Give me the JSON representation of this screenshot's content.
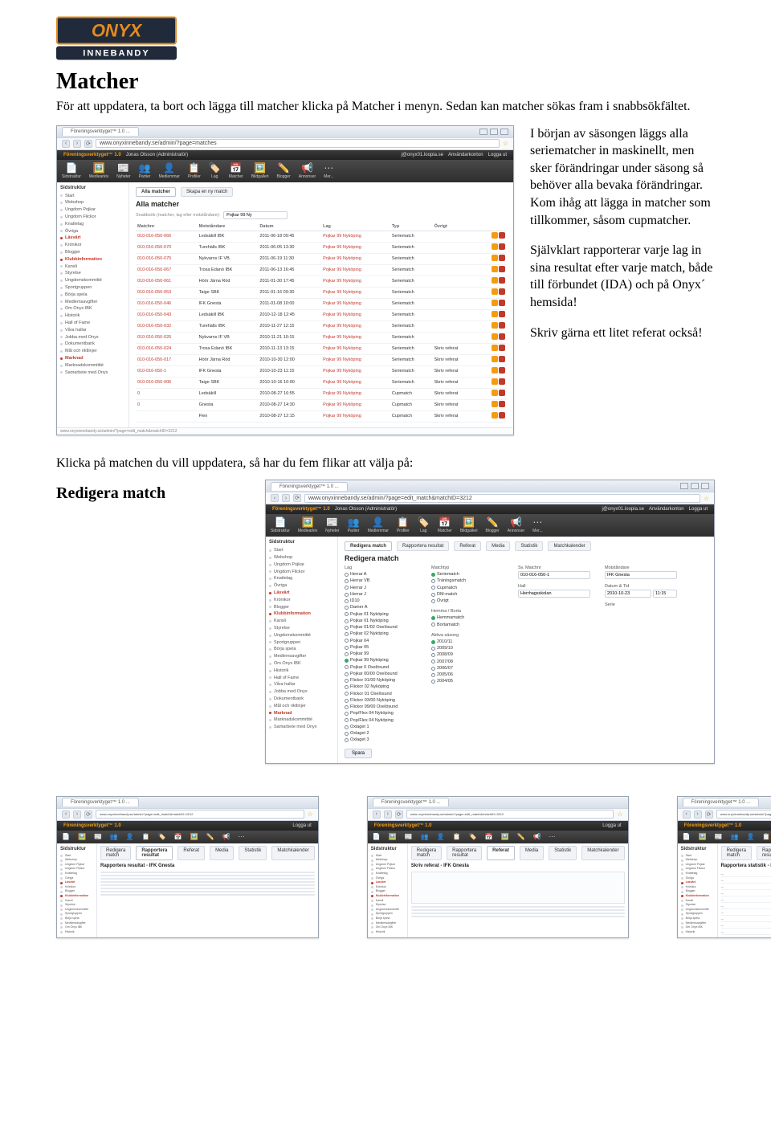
{
  "logo": {
    "brand_top": "ONYX",
    "brand_bottom": "INNEBANDY"
  },
  "heading": "Matcher",
  "intro": "För att uppdatera, ta bort och lägga till matcher klicka på Matcher i menyn. Sedan kan matcher sökas fram i snabbsökfältet.",
  "side_paragraphs": {
    "p1": "I början av säsongen läggs alla seriematcher in maskinellt, men sker förändringar under säsong så behöver alla bevaka förändringar. Kom ihåg att lägga in matcher som tillkommer, såsom cupmatcher.",
    "p2": "Självklart rapporterar varje lag in sina resultat efter varje match, både till förbundet (IDA) och på Onyx´ hemsida!",
    "p3": "Skriv gärna ett litet referat också!"
  },
  "middle_text": "Klicka på matchen du vill uppdatera, så har du fem flikar att välja på:",
  "subhead": "Redigera match",
  "browser": {
    "tab_title": "Föreningsverktyget™ 1.0 ...",
    "url_matches": "www.onyxinnebandy.se/admin/?page=matches",
    "url_edit": "www.onyxinnebandy.se/admin/?page=edit_match&matchID=3212",
    "footer_url": "www.onyxinnebandy.se/admin/?page=edit_match&matchID=3212"
  },
  "app_header": {
    "brand": "Föreningsverktyget™ 1.0",
    "user": "Jonas Olsson (Administratör)",
    "email": "j@onyx01.loopia.se",
    "link1": "Användarkonton",
    "link2": "Logga ut"
  },
  "iconbar": [
    {
      "emoji": "📄",
      "label": "Sidstruktur"
    },
    {
      "emoji": "🖼️",
      "label": "Mediearkiv"
    },
    {
      "emoji": "📰",
      "label": "Nyheter"
    },
    {
      "emoji": "👥",
      "label": "Partier"
    },
    {
      "emoji": "👤",
      "label": "Medlemmar"
    },
    {
      "emoji": "📋",
      "label": "Profiler"
    },
    {
      "emoji": "🏷️",
      "label": "Lag"
    },
    {
      "emoji": "📅",
      "label": "Matcher"
    },
    {
      "emoji": "🖼️",
      "label": "Bildgalleri"
    },
    {
      "emoji": "✏️",
      "label": "Blogger"
    },
    {
      "emoji": "📢",
      "label": "Annonser"
    },
    {
      "emoji": "⋯",
      "label": "Mer..."
    }
  ],
  "sidebar_title": "Sidstruktur",
  "sidebar_items": [
    {
      "label": "Start",
      "sec": false
    },
    {
      "label": "Webshop",
      "sec": false
    },
    {
      "label": "Ungdom Pojkar",
      "sec": false
    },
    {
      "label": "Ungdom Flickor",
      "sec": false
    },
    {
      "label": "Knattelag",
      "sec": false
    },
    {
      "label": "Övriga",
      "sec": false
    },
    {
      "label": "Läsvärt",
      "sec": true
    },
    {
      "label": "Krönikor",
      "sec": false
    },
    {
      "label": "Blogger",
      "sec": false
    },
    {
      "label": "Klubbinformation",
      "sec": true
    },
    {
      "label": "Kansli",
      "sec": false
    },
    {
      "label": "Styrelse",
      "sec": false
    },
    {
      "label": "Ungdomskommitté",
      "sec": false
    },
    {
      "label": "Sportgruppen",
      "sec": false
    },
    {
      "label": "Börja spela",
      "sec": false
    },
    {
      "label": "Medlemsavgifter",
      "sec": false
    },
    {
      "label": "Om Onyx IBK",
      "sec": false
    },
    {
      "label": "Historik",
      "sec": false
    },
    {
      "label": "Hall of Fame",
      "sec": false
    },
    {
      "label": "Våra hallar",
      "sec": false
    },
    {
      "label": "Jobba med Onyx",
      "sec": false
    },
    {
      "label": "Dokumentbank",
      "sec": false
    },
    {
      "label": "Mål och riktlinjer",
      "sec": false
    },
    {
      "label": "Marknad",
      "sec": true
    },
    {
      "label": "Marknadskommittté",
      "sec": false
    },
    {
      "label": "Samarbete med Onyx",
      "sec": false
    }
  ],
  "matches_screen": {
    "tab1": "Alla matcher",
    "tab2": "Skapa en ny match",
    "title": "Alla matcher",
    "filter_label": "Snabbsök (matcher, lag eller motståndare):",
    "filter_value": "Pojkar 99 Ny",
    "columns": [
      "Matchnr",
      "Motståndare",
      "Datum",
      "Lag",
      "Typ",
      "Övrigt"
    ],
    "rows": [
      {
        "id": "010-016-050-066",
        "opp": "Ledsäkill IBK",
        "date": "2011-06-18 09:45",
        "team": "Pojkar 99 Nyköping",
        "type": "Seriematch",
        "extra": ""
      },
      {
        "id": "010-016-050-070",
        "opp": "Turehälls IBK",
        "date": "2011-06-05 13:30",
        "team": "Pojkar 99 Nyköping",
        "type": "Seriematch",
        "extra": ""
      },
      {
        "id": "010-016-050-075",
        "opp": "Nykvarns IF VB",
        "date": "2011-06-19 11:30",
        "team": "Pojkar 99 Nyköping",
        "type": "Seriematch",
        "extra": ""
      },
      {
        "id": "010-016-050-067",
        "opp": "Trosa Edanö IBK",
        "date": "2011-06-13 16:45",
        "team": "Pojkar 99 Nyköping",
        "type": "Seriematch",
        "extra": ""
      },
      {
        "id": "010-016-050-061",
        "opp": "Höör Järna Röd",
        "date": "2011-01-30 17:45",
        "team": "Pojkar 99 Nyköping",
        "type": "Seriematch",
        "extra": ""
      },
      {
        "id": "010-016-050-053",
        "opp": "Taige SBK",
        "date": "2011-01-16 09:30",
        "team": "Pojkar 99 Nyköping",
        "type": "Seriematch",
        "extra": ""
      },
      {
        "id": "010-016-050-046",
        "opp": "IFK Gnesta",
        "date": "2011-01-08 10:00",
        "team": "Pojkar 99 Nyköping",
        "type": "Seriematch",
        "extra": ""
      },
      {
        "id": "010-016-050-043",
        "opp": "Ledsäkill IBK",
        "date": "2010-12-18 12:45",
        "team": "Pojkar 99 Nyköping",
        "type": "Seriematch",
        "extra": ""
      },
      {
        "id": "010-016-050-032",
        "opp": "Turehälls IBK",
        "date": "2010-11-27 12:15",
        "team": "Pojkar 99 Nyköping",
        "type": "Seriematch",
        "extra": ""
      },
      {
        "id": "010-016-050-026",
        "opp": "Nykvarns IF VB",
        "date": "2010-11-21 10:15",
        "team": "Pojkar 99 Nyköping",
        "type": "Seriematch",
        "extra": ""
      },
      {
        "id": "010-016-050-024",
        "opp": "Trosa Edanö IBK",
        "date": "2010-11-13 13:15",
        "team": "Pojkar 99 Nyköping",
        "type": "Seriematch",
        "extra": "Skriv referat"
      },
      {
        "id": "010-016-050-017",
        "opp": "Höör Järna Röd",
        "date": "2010-10-30 12:00",
        "team": "Pojkar 99 Nyköping",
        "type": "Seriematch",
        "extra": "Skriv referat"
      },
      {
        "id": "010-016-050-1",
        "opp": "IFK Gnesta",
        "date": "2010-10-23 11:15",
        "team": "Pojkar 99 Nyköping",
        "type": "Seriematch",
        "extra": "Skriv referat"
      },
      {
        "id": "010-016-050-006",
        "opp": "Taige SBK",
        "date": "2010-10-16 10:00",
        "team": "Pojkar 99 Nyköping",
        "type": "Seriematch",
        "extra": "Skriv referat"
      },
      {
        "id": "0",
        "opp": "Ledsäkill",
        "date": "2010-08-27 16:55",
        "team": "Pojkar 99 Nyköping",
        "type": "Cupmatch",
        "extra": "Skriv referat"
      },
      {
        "id": "0",
        "opp": "Gnesta",
        "date": "2010-08-27 14:30",
        "team": "Pojkar 99 Nyköping",
        "type": "Cupmatch",
        "extra": "Skriv referat"
      },
      {
        "id": "",
        "opp": "Flen",
        "date": "2010-08-27 12:15",
        "team": "Pojkar 99 Nyköping",
        "type": "Cupmatch",
        "extra": "Skriv referat"
      }
    ]
  },
  "edit_screen": {
    "tabs": [
      "Redigera match",
      "Rapportera resultat",
      "Referat",
      "Media",
      "Statistik",
      "Matchkalender"
    ],
    "active_tab": 0,
    "title": "Redigera match",
    "col_lag_label": "Lag",
    "col_lag": [
      "Herrar A",
      "Herrar VB",
      "Herrar J",
      "Herrar J",
      "ID10",
      "Damer A",
      "Pojkar 01 Nyköping",
      "Pojkar 01 Nyköping",
      "Pojkar 01/02 Oxelösund",
      "Pojkar 02 Nyköping",
      "Pojkar 04",
      "Pojkar 05",
      "Pojkar 99",
      "Pojkar 99 Nyköping",
      "Pojkar 0 Oxelösund",
      "Pojkar 00/00 Oxelösund",
      "Flickor 01/00 Nyköping",
      "Flickor 02 Nyköping",
      "Flickor 01 Oxelösund",
      "Flickor 03/00 Nyköping",
      "Flickor 99/00 Oxelösund",
      "Pop/Flex 04 Nyköping",
      "Pop/Flex 04 Nyköping",
      "Oxlaget 1",
      "Oxlaget 2",
      "Oxlaget 3"
    ],
    "col_lag_selected": 13,
    "col_matchtyp_label": "Matchtyp",
    "col_matchtyp": [
      "Seriematch",
      "Träningsmatch",
      "Cupmatch",
      "DM-match",
      "Övrigt"
    ],
    "col_matchtyp_selected": 0,
    "col_hb_label": "Hemma / Borta",
    "col_hb": [
      "Hemmamatch",
      "Bortamatch"
    ],
    "col_hb_selected": 0,
    "col_sasong_label": "Aktiva säsong",
    "col_sasong": [
      "2010/11",
      "2009/10",
      "2008/09",
      "2007/08",
      "2006/07",
      "2005/06",
      "2004/05"
    ],
    "col_sasong_selected": 0,
    "sv_label": "Sv. Matchnr",
    "sv_value": "010-016-050-1",
    "mot_label": "Motståndare",
    "mot_value": "IFK Gnesta",
    "hall_label": "Hall",
    "hall_value": "Herrhagsskolan",
    "dt_label": "Datum & Tid",
    "dt_date": "2010-10-23",
    "dt_time": "11:15",
    "serie_label": "Serie",
    "save_btn": "Spara"
  },
  "thumb1": {
    "title": "Rapportera resultat - IFK Gnesta"
  },
  "thumb2": {
    "title": "Skriv referat - IFK Gnesta"
  },
  "thumb3": {
    "title": "Rapportera statistik - IFK Gnesta"
  }
}
